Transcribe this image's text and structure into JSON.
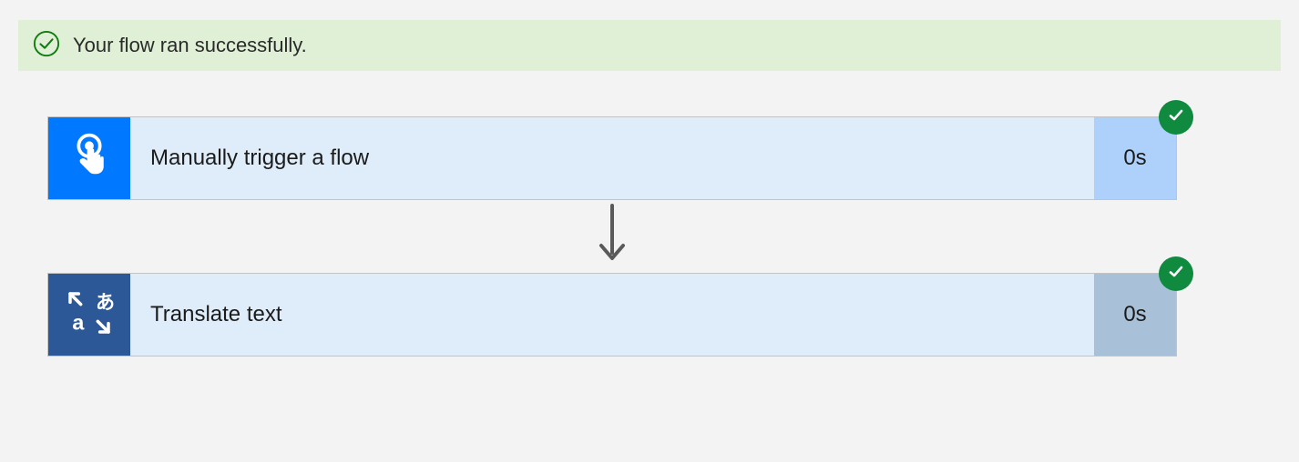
{
  "banner": {
    "message": "Your flow ran successfully."
  },
  "colors": {
    "banner_bg": "#dff0d6",
    "step_bg": "#dfecf9",
    "badge_bg": "#0f8a3f",
    "icon1_bg": "#0078ff",
    "icon2_bg": "#2c5898",
    "time1_bg": "#aed1fb",
    "time2_bg": "#a9c1d8"
  },
  "steps": [
    {
      "title": "Manually trigger a flow",
      "duration": "0s",
      "icon": "touch-icon",
      "status": "success"
    },
    {
      "title": "Translate text",
      "duration": "0s",
      "icon": "translate-icon",
      "status": "success"
    }
  ]
}
